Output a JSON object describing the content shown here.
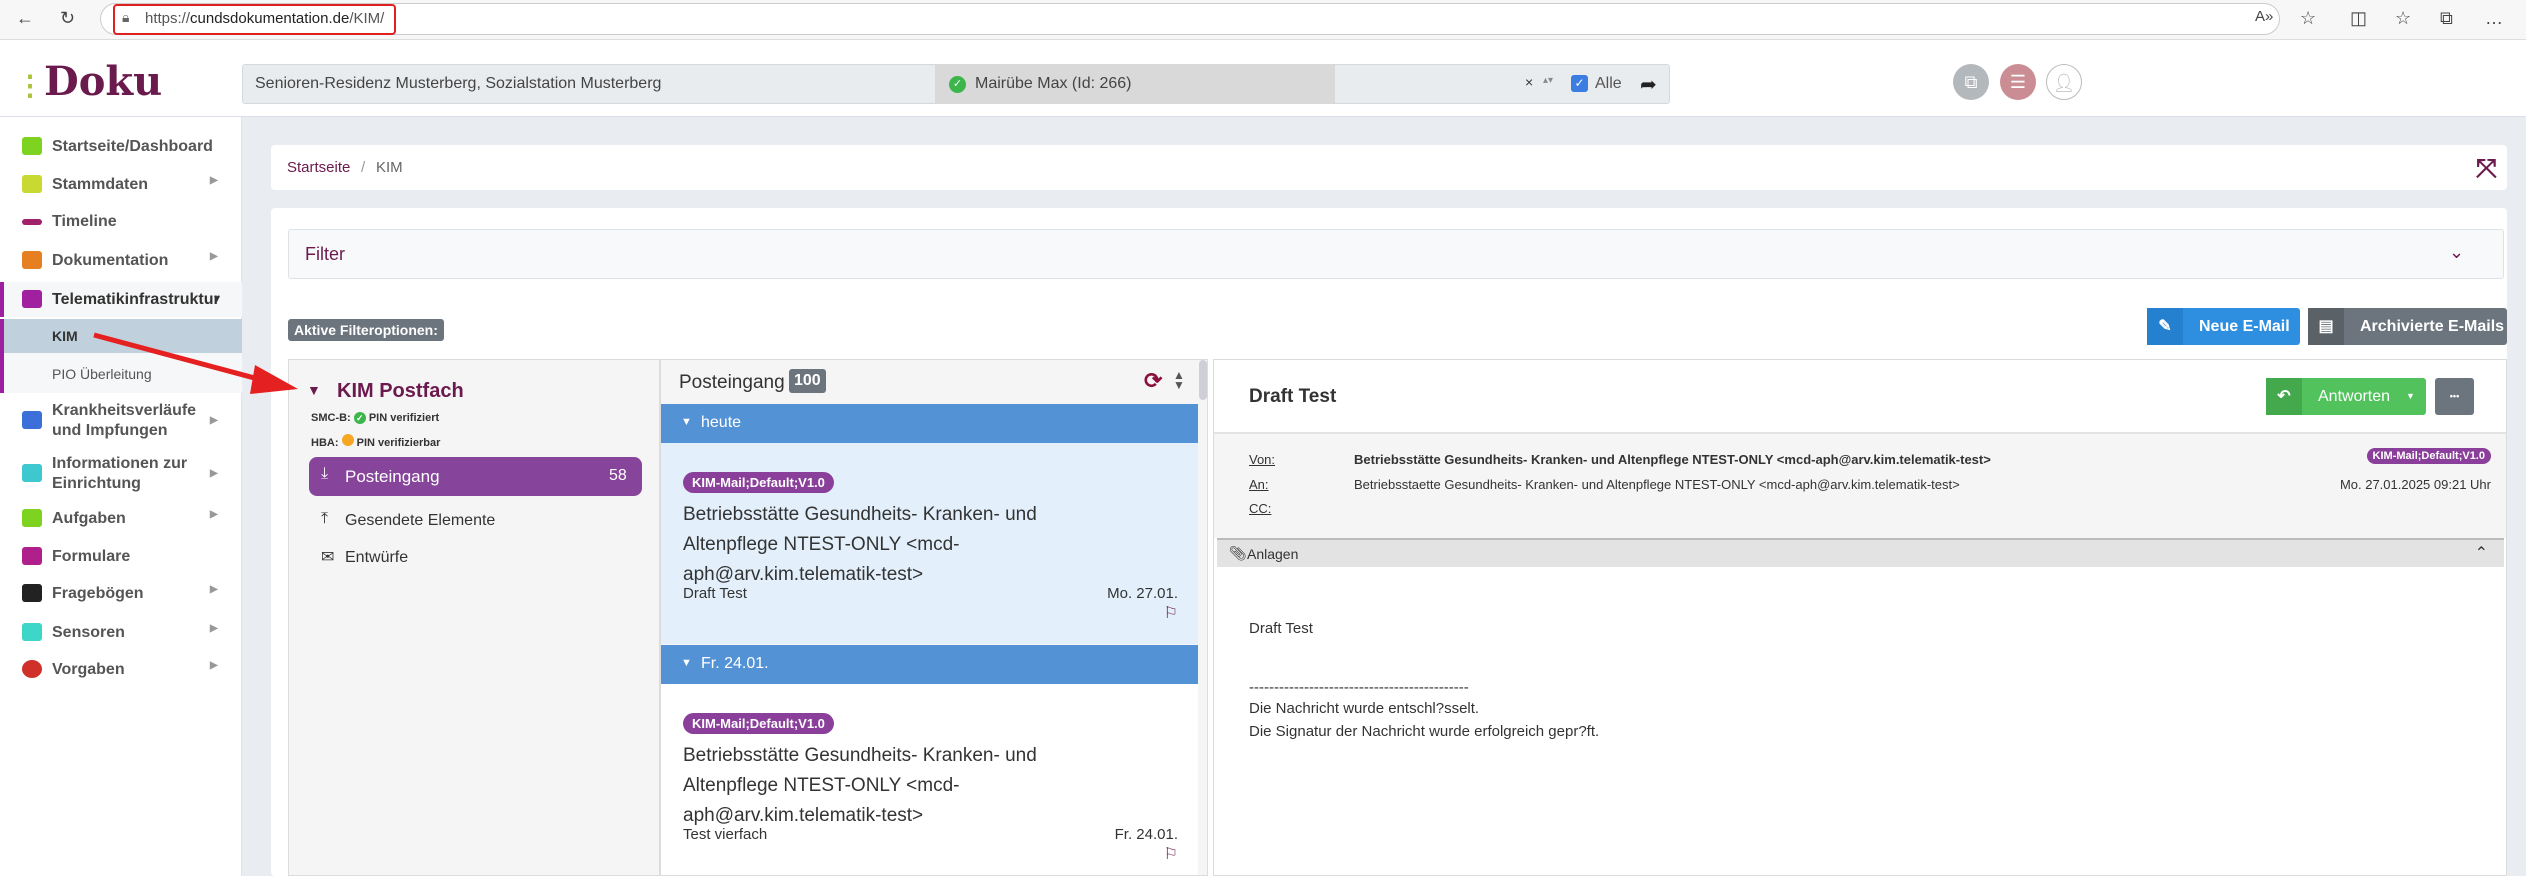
{
  "browser": {
    "url_prefix": "https://",
    "url_domain": "cundsdokumentation.de",
    "url_path": "/KIM/"
  },
  "header": {
    "logo": "Doku",
    "facility": "Senioren-Residenz Musterberg, Sozialstation Musterberg",
    "resident": "Mairübe Max (Id: 266)",
    "clear": "×",
    "all_label": "Alle"
  },
  "sidebar": {
    "items": [
      {
        "label": "Startseite/Dashboard",
        "color": "#7ed321"
      },
      {
        "label": "Stammdaten",
        "color": "#c8d932"
      },
      {
        "label": "Timeline",
        "color": "#a0206a"
      },
      {
        "label": "Dokumentation",
        "color": "#e67e22"
      },
      {
        "label": "Telematikinfrastruktur",
        "color": "#a020a0"
      },
      {
        "label": "KIM"
      },
      {
        "label": "PIO Überleitung"
      },
      {
        "label": "Krankheitsverläufe und Impfungen",
        "color": "#3b6fd9"
      },
      {
        "label": "Informationen zur Einrichtung",
        "color": "#3dc8d0"
      },
      {
        "label": "Aufgaben",
        "color": "#7ed321"
      },
      {
        "label": "Formulare",
        "color": "#b0208a"
      },
      {
        "label": "Fragebögen",
        "color": "#222"
      },
      {
        "label": "Sensoren",
        "color": "#3dd6c8"
      },
      {
        "label": "Vorgaben",
        "color": "#d0302a"
      }
    ]
  },
  "breadcrumb": {
    "home": "Startseite",
    "sep": "/",
    "current": "KIM"
  },
  "filter": {
    "title": "Filter",
    "active_label": "Aktive Filteroptionen:"
  },
  "actions": {
    "new_mail": "Neue E-Mail",
    "archived": "Archivierte E-Mails"
  },
  "mailbox": {
    "title": "KIM Postfach",
    "smcb_label": "SMC-B:",
    "smcb_status": "PIN verifiziert",
    "hba_label": "HBA:",
    "hba_status": "PIN verifizierbar",
    "folders": [
      {
        "label": "Posteingang",
        "count": "58"
      },
      {
        "label": "Gesendete Elemente"
      },
      {
        "label": "Entwürfe"
      }
    ]
  },
  "list": {
    "title": "Posteingang",
    "count": "100",
    "groups": [
      {
        "label": "heute",
        "mail": {
          "tag": "KIM-Mail;Default;V1.0",
          "from1": "Betriebsstätte Gesundheits- Kranken- und",
          "from2": "Altenpflege NTEST-ONLY <mcd-",
          "from3": "aph@arv.kim.telematik-test>",
          "subject": "Draft Test",
          "date": "Mo. 27.01."
        }
      },
      {
        "label": "Fr. 24.01.",
        "mail": {
          "tag": "KIM-Mail;Default;V1.0",
          "from1": "Betriebsstätte Gesundheits- Kranken- und",
          "from2": "Altenpflege NTEST-ONLY <mcd-",
          "from3": "aph@arv.kim.telematik-test>",
          "subject": "Test vierfach",
          "date": "Fr. 24.01."
        }
      }
    ]
  },
  "detail": {
    "subject": "Draft Test",
    "reply": "Antworten",
    "more": "•••",
    "from_label": "Von:",
    "from": "Betriebsstätte Gesundheits- Kranken- und Altenpflege NTEST-ONLY <mcd-aph@arv.kim.telematik-test>",
    "to_label": "An:",
    "to": "Betriebsstaette Gesundheits- Kranken- und Altenpflege NTEST-ONLY <mcd-aph@arv.kim.telematik-test>",
    "cc_label": "CC:",
    "tag": "KIM-Mail;Default;V1.0",
    "date": "Mo. 27.01.2025 09:21 Uhr",
    "attachments": "Anlagen",
    "body": [
      "Draft Test",
      "--------------------------------------------",
      "Die Nachricht wurde entschl?sselt.",
      "Die Signatur der Nachricht wurde erfolgreich gepr?ft."
    ]
  }
}
